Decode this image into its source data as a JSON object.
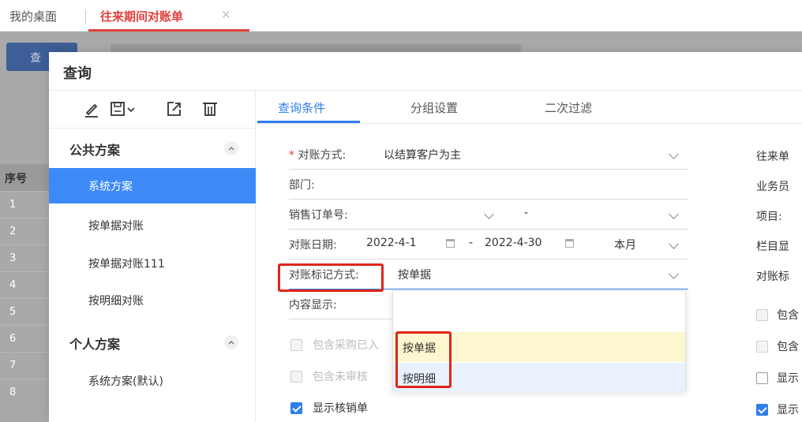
{
  "top_tabs": {
    "home": "我的桌面",
    "active": "往来期间对账单",
    "close": "×"
  },
  "bg_app": {
    "query_button": "查",
    "grid_header": "序号",
    "grid_rows": [
      "1",
      "2",
      "3",
      "4",
      "5",
      "6",
      "7",
      "8"
    ]
  },
  "modal": {
    "title": "查询",
    "left": {
      "public_group": "公共方案",
      "public_schemes": [
        "系统方案",
        "按单据对账",
        "按单据对账111",
        "按明细对账"
      ],
      "personal_group": "个人方案",
      "personal_schemes": [
        "系统方案(默认)"
      ]
    },
    "tabs": [
      "查询条件",
      "分组设置",
      "二次过滤"
    ],
    "form": {
      "mode_required": "*",
      "mode_label": "对账方式:",
      "mode_value": "以结算客户为主",
      "dept_label": "部门:",
      "so_label": "销售订单号:",
      "so_sep": "-",
      "date_label": "对账日期:",
      "date_from": "2022-4-1",
      "date_sep": "-",
      "date_to": "2022-4-30",
      "date_preset": "本月",
      "mark_label": "对账标记方式:",
      "mark_value": "按单据",
      "content_label": "内容显示:",
      "cb_purchase": "包含采购已入",
      "cb_unaudited": "包含未审核",
      "cb_writeoff": "显示核销单"
    },
    "dropdown": {
      "options": [
        "按单据",
        "按明细"
      ]
    },
    "right_col": {
      "r1": "往来单",
      "r2": "业务员",
      "r3": "项目:",
      "r4": "栏目显",
      "r5": "对账标",
      "r6": "包含",
      "r7": "包含",
      "r8": "显示",
      "r9": "显示"
    }
  },
  "colors": {
    "accent": "#2f7ded",
    "highlight": "#e0241b",
    "selected_scheme": "#3d8af7",
    "brand_red": "#e0403a"
  }
}
